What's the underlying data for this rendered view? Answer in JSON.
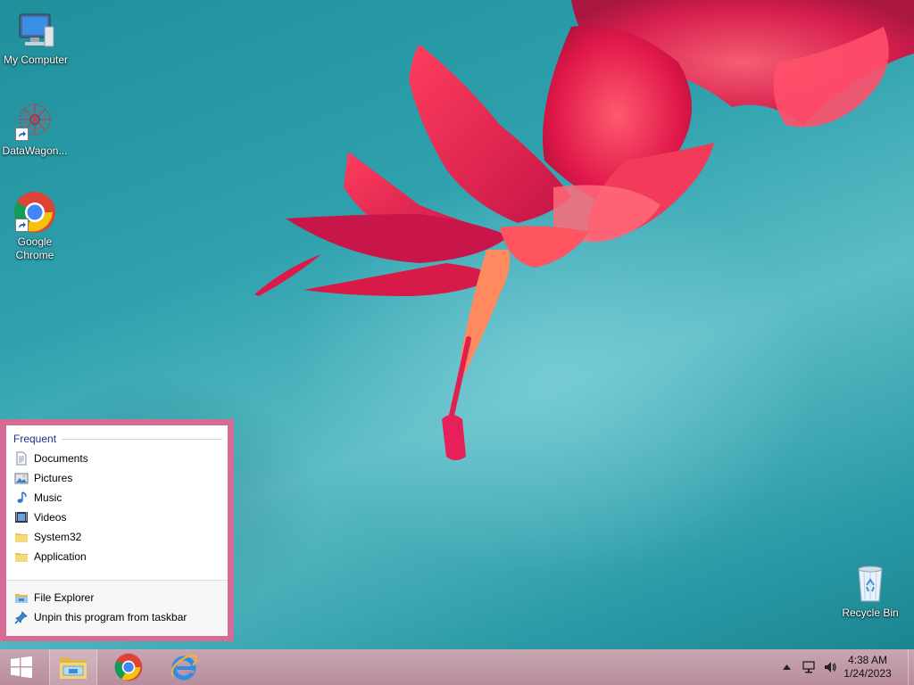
{
  "desktop_icons": [
    {
      "label": "My Computer"
    },
    {
      "label": "DataWagon..."
    },
    {
      "label": "Google Chrome"
    },
    {
      "label": "Recycle Bin"
    }
  ],
  "jumplist": {
    "header": "Frequent",
    "frequent_items": [
      {
        "label": "Documents",
        "icon": "document-icon"
      },
      {
        "label": "Pictures",
        "icon": "pictures-icon"
      },
      {
        "label": "Music",
        "icon": "music-icon"
      },
      {
        "label": "Videos",
        "icon": "videos-icon"
      },
      {
        "label": "System32",
        "icon": "folder-icon"
      },
      {
        "label": "Application",
        "icon": "folder-icon"
      }
    ],
    "tasks": [
      {
        "label": "File Explorer",
        "icon": "file-explorer-icon"
      },
      {
        "label": "Unpin this program from taskbar",
        "icon": "unpin-icon"
      }
    ]
  },
  "taskbar": {
    "pinned": [
      "windows-start-icon",
      "file-explorer-icon",
      "chrome-icon",
      "internet-explorer-icon"
    ],
    "clock": {
      "time": "4:38 AM",
      "date": "1/24/2023"
    }
  },
  "colors": {
    "jumplist_border": "#d66b95",
    "header_text": "#1e3287",
    "taskbar": "#c09aa8",
    "desktop": "#2ea1ad"
  }
}
